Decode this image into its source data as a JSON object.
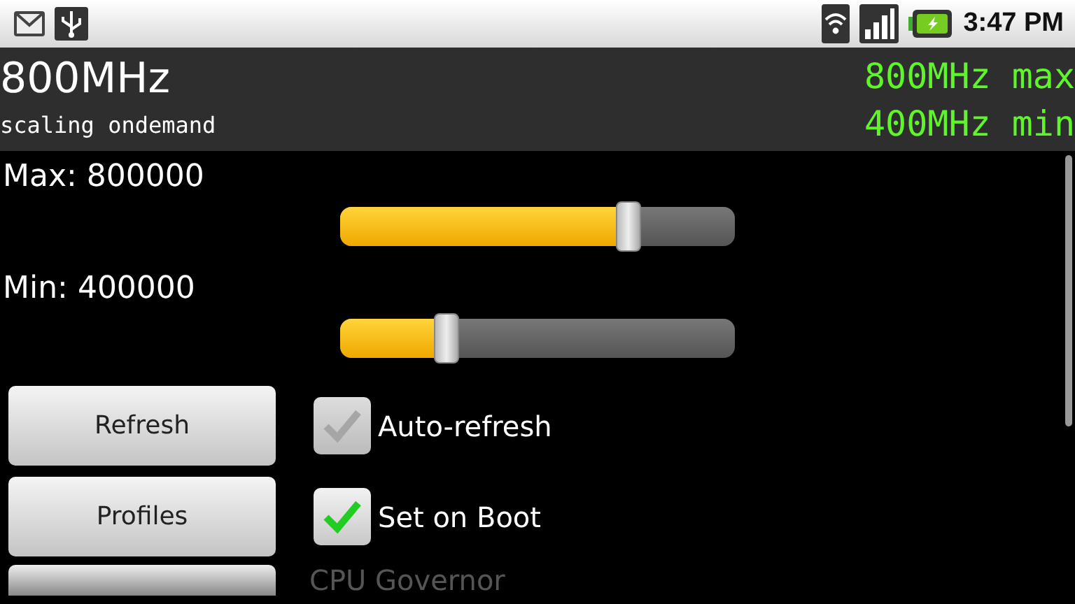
{
  "status_bar": {
    "time": "3:47 PM"
  },
  "header": {
    "frequency": "800MHz",
    "governor": "scaling ondemand",
    "max": "800MHz max",
    "min": "400MHz min"
  },
  "sliders": [
    {
      "label": "Max: 800000",
      "level": 0.73
    },
    {
      "label": "Min: 400000",
      "level": 0.27
    }
  ],
  "rows": [
    {
      "button": "Refresh",
      "checkbox": {
        "label": "Auto-refresh",
        "checked": true,
        "disabled": true
      }
    },
    {
      "button": "Profiles",
      "checkbox": {
        "label": "Set on Boot",
        "checked": true,
        "disabled": false
      }
    }
  ],
  "section_label": "CPU Governor"
}
